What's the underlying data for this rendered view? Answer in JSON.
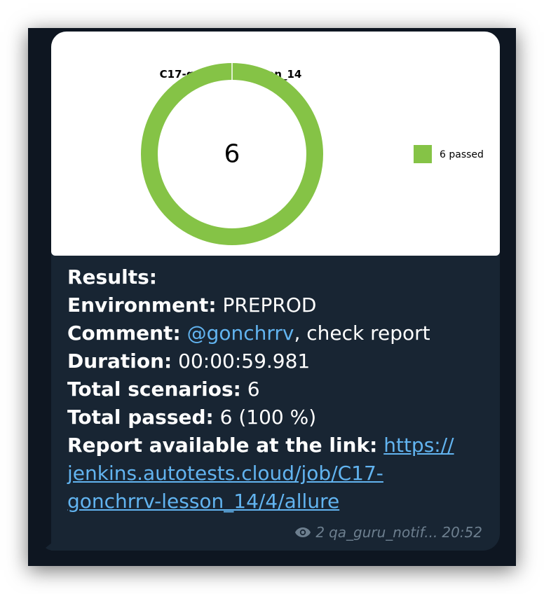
{
  "chart": {
    "title": "C17-gonchrrv-lesson_14",
    "center_text": "6",
    "legend_label": "6 passed",
    "color_passed": "#85c346"
  },
  "chart_data": {
    "type": "pie",
    "title": "C17-gonchrrv-lesson_14",
    "categories": [
      "passed"
    ],
    "values": [
      6
    ],
    "legend": [
      "6 passed"
    ],
    "center_label": "6"
  },
  "message": {
    "results_label": "Results:",
    "environment_label": "Environment:",
    "environment_value": "PREPROD",
    "comment_label": "Comment:",
    "comment_mention": "@gonchrrv",
    "comment_text": ", check report",
    "duration_label": "Duration:",
    "duration_value": "00:00:59.981",
    "total_scenarios_label": "Total scenarios:",
    "total_scenarios_value": "6",
    "total_passed_label": "Total passed:",
    "total_passed_value": "6 (100 %)",
    "report_label": "Report available at the link:",
    "report_link_line1": "https://",
    "report_link_line2": "jenkins.autotests.cloud/job/C17-",
    "report_link_line3": "gonchrrv-lesson_14/4/allure"
  },
  "meta": {
    "views_icon": "eye-icon",
    "views": "2",
    "author": "qa_guru_notif...",
    "time": "20:52"
  }
}
